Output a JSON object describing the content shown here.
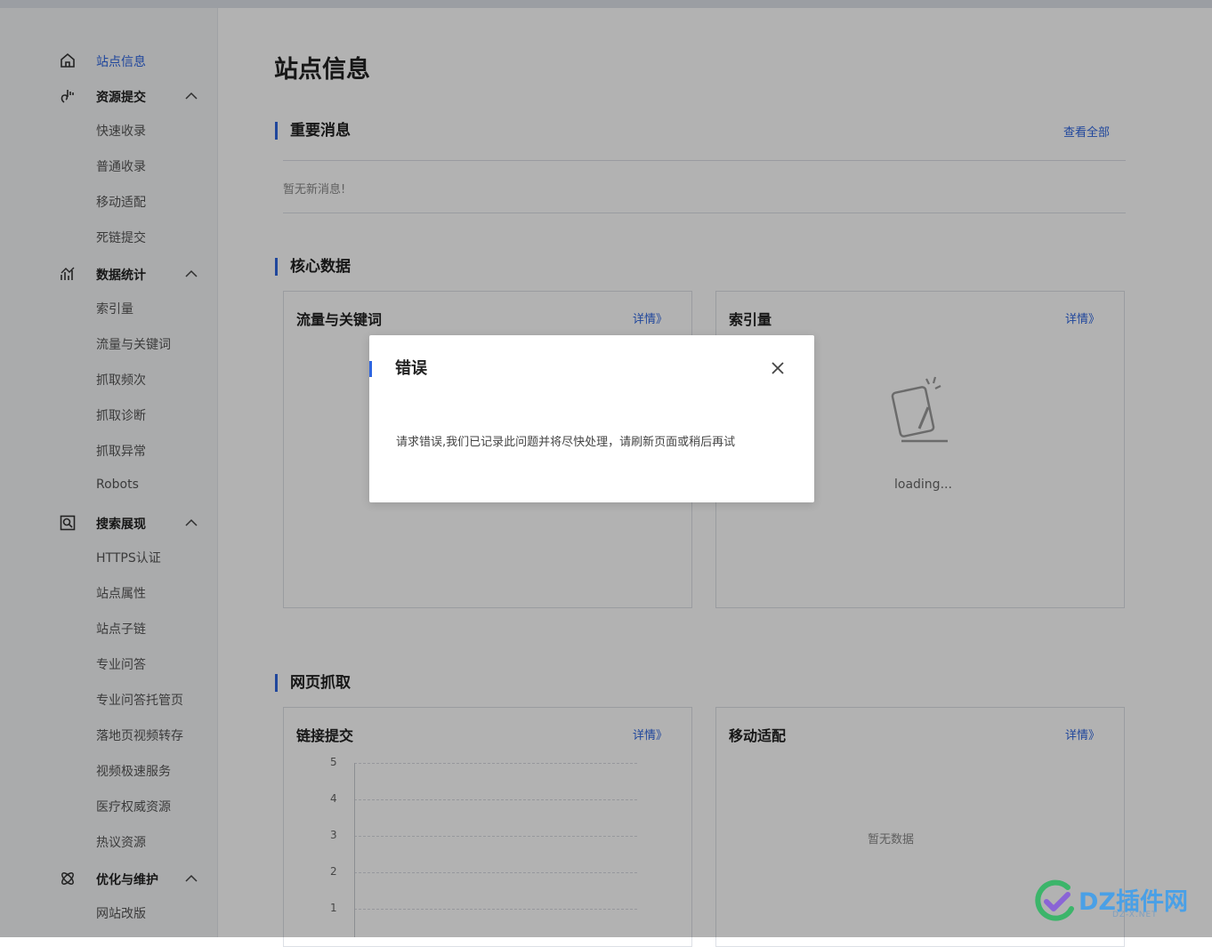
{
  "sidebar": {
    "items": [
      {
        "label": "站点信息",
        "active": true,
        "icon": "home-icon"
      },
      {
        "label": "资源提交",
        "icon": "resource-submit-icon",
        "children": [
          "快速收录",
          "普通收录",
          "移动适配",
          "死链提交"
        ]
      },
      {
        "label": "数据统计",
        "icon": "chart-icon",
        "children": [
          "索引量",
          "流量与关键词",
          "抓取频次",
          "抓取诊断",
          "抓取异常",
          "Robots"
        ]
      },
      {
        "label": "搜索展现",
        "icon": "search-display-icon",
        "children": [
          "HTTPS认证",
          "站点属性",
          "站点子链",
          "专业问答",
          "专业问答托管页",
          "落地页视频转存",
          "视频极速服务",
          "医疗权威资源",
          "热议资源"
        ]
      },
      {
        "label": "优化与维护",
        "icon": "optimize-icon",
        "children": [
          "网站改版"
        ]
      }
    ]
  },
  "main": {
    "page_title": "站点信息",
    "messages": {
      "title": "重要消息",
      "view_all": "查看全部",
      "empty": "暂无新消息!"
    },
    "core": {
      "title": "核心数据",
      "traffic_card": {
        "title": "流量与关键词",
        "detail": "详情》"
      },
      "index_card": {
        "title": "索引量",
        "detail": "详情》",
        "loading": "loading..."
      }
    },
    "crawl": {
      "title": "网页抓取",
      "link_card": {
        "title": "链接提交",
        "detail": "详情》",
        "y_ticks": [
          "5",
          "4",
          "3",
          "2",
          "1"
        ]
      },
      "mobile_card": {
        "title": "移动适配",
        "detail": "详情》",
        "empty": "暂无数据"
      }
    }
  },
  "modal": {
    "title": "错误",
    "message": "请求错误,我们已记录此问题并将尽快处理，请刷新页面或稍后再试",
    "close_icon": "close-icon"
  },
  "watermark": {
    "brand": "DZ插件网",
    "sub": "DZ-X.NET"
  },
  "colors": {
    "accent": "#2f66e0",
    "overlay": "rgba(0,0,0,0.30)"
  }
}
